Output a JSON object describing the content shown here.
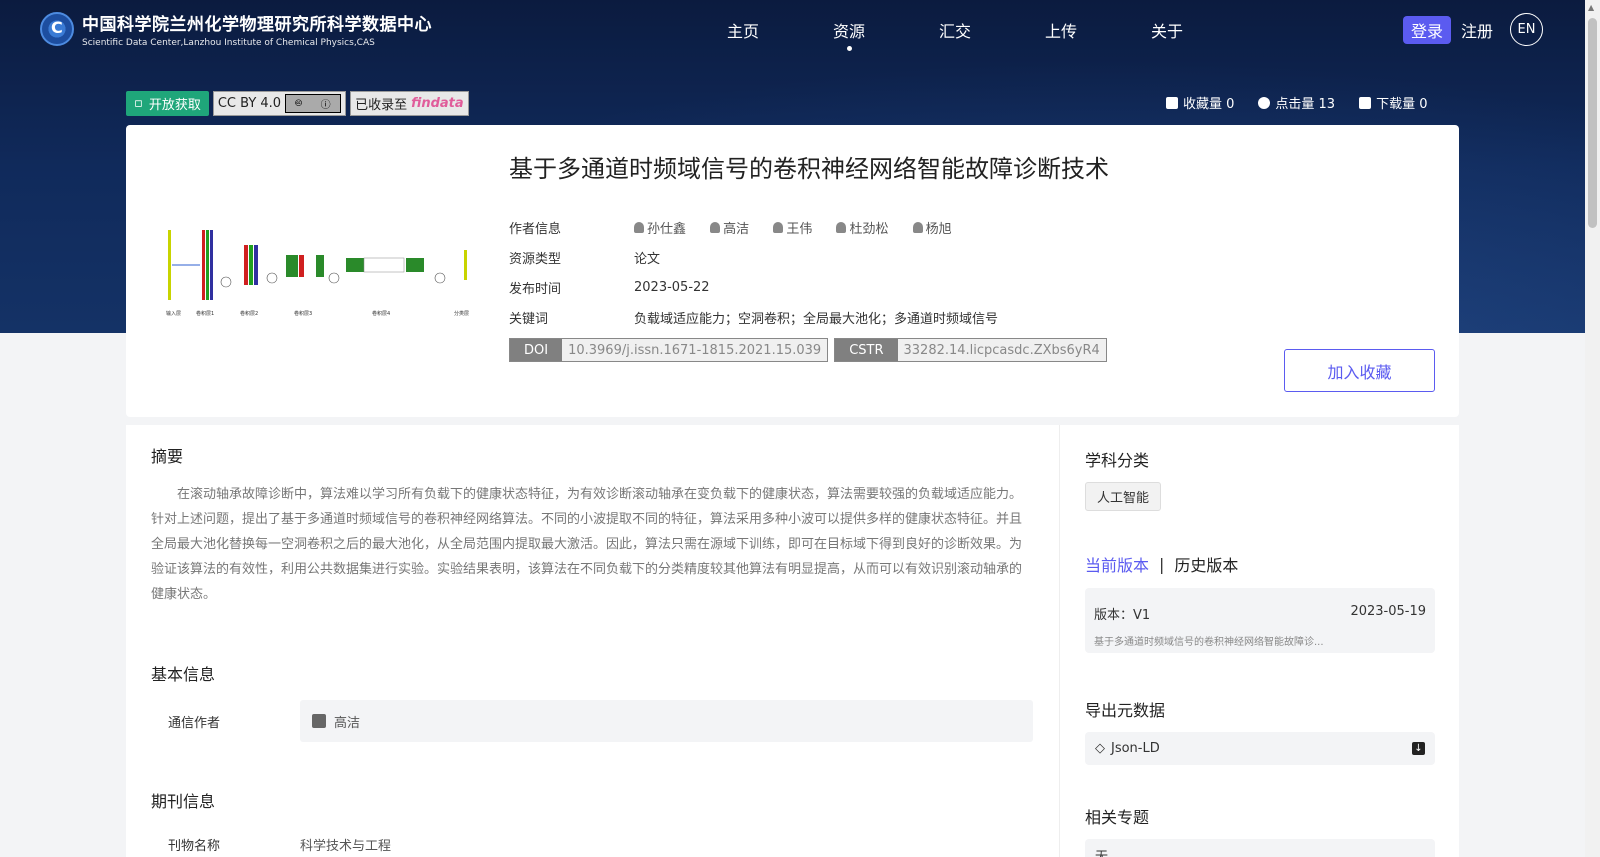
{
  "header": {
    "logo_cn": "中国科学院兰州化学物理研究所科学数据中心",
    "logo_en": "Scientific Data Center,Lanzhou Institute of Chemical Physics,CAS",
    "nav": [
      "主页",
      "资源",
      "汇交",
      "上传",
      "关于"
    ],
    "active_nav": "资源",
    "login": "登录",
    "register": "注册",
    "lang": "EN"
  },
  "badges": {
    "open_access": "开放获取",
    "license": "CC BY 4.0",
    "indexed": "已收录至",
    "indexed_brand": "findata"
  },
  "stats": {
    "favorites": "收藏量 0",
    "clicks": "点击量 13",
    "downloads": "下载量 0"
  },
  "resource": {
    "title": "基于多通道时频域信号的卷积神经网络智能故障诊断技术",
    "author_label": "作者信息",
    "authors": [
      "孙仕鑫",
      "高洁",
      "王伟",
      "杜劲松",
      "杨旭"
    ],
    "type_label": "资源类型",
    "type": "论文",
    "date_label": "发布时间",
    "date": "2023-05-22",
    "keywords_label": "关键词",
    "keywords": "负载域适应能力；空洞卷积；全局最大池化；多通道时频域信号",
    "doi_label": "DOI",
    "doi": "10.3969/j.issn.1671-1815.2021.15.039",
    "cstr_label": "CSTR",
    "cstr": "33282.14.licpcasdc.ZXbs6yR4",
    "fav_button": "加入收藏"
  },
  "figure_labels": [
    "输入层",
    "卷积层1",
    "卷积层2",
    "卷积层3",
    "卷积层4",
    "分类层"
  ],
  "abstract": {
    "heading": "摘要",
    "text": "在滚动轴承故障诊断中，算法难以学习所有负载下的健康状态特征，为有效诊断滚动轴承在变负载下的健康状态，算法需要较强的负载域适应能力。针对上述问题，提出了基于多通道时频域信号的卷积神经网络算法。不同的小波提取不同的特征，算法采用多种小波可以提供多样的健康状态特征。并且全局最大池化替换每一空洞卷积之后的最大池化，从全局范围内提取最大激活。因此，算法只需在源域下训练，即可在目标域下得到良好的诊断效果。为验证该算法的有效性，利用公共数据集进行实验。实验结果表明，该算法在不同负载下的分类精度较其他算法有明显提高，从而可以有效识别滚动轴承的健康状态。"
  },
  "basic_info": {
    "heading": "基本信息",
    "corr_label": "通信作者",
    "corr_value": "高洁"
  },
  "journal_info": {
    "heading": "期刊信息",
    "name_label": "刊物名称",
    "name_value": "科学技术与工程"
  },
  "sidebar": {
    "subject_heading": "学科分类",
    "subject_tag": "人工智能",
    "current_version": "当前版本",
    "history_version": "历史版本",
    "version_label": "版本：V1",
    "version_date": "2023-05-19",
    "version_desc": "基于多通道时频域信号的卷积神经网络智能故障诊...",
    "export_heading": "导出元数据",
    "export_format": "Json-LD",
    "related_heading": "相关专题",
    "related_value": "无"
  }
}
